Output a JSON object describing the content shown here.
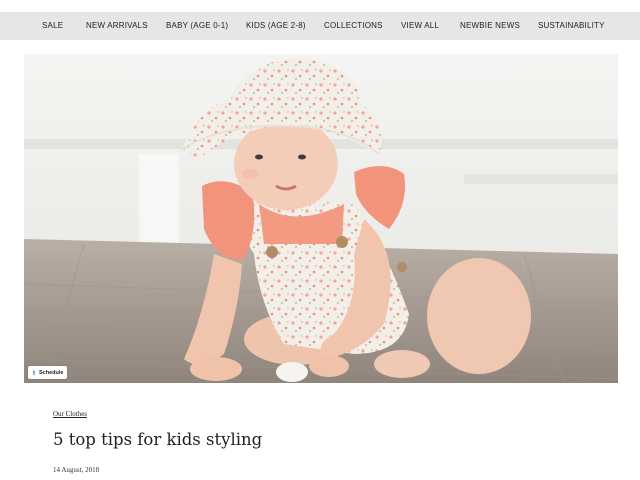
{
  "nav": {
    "items": [
      {
        "label": "SALE"
      },
      {
        "label": "NEW ARRIVALS"
      },
      {
        "label": "BABY (AGE 0-1)"
      },
      {
        "label": "KIDS (AGE 2-8)"
      },
      {
        "label": "COLLECTIONS"
      },
      {
        "label": "VIEW ALL"
      },
      {
        "label": "NEWBIE NEWS"
      },
      {
        "label": "SUSTAINABILITY"
      }
    ]
  },
  "hero": {
    "schedule_label": "Schedule",
    "schedule_icon": "pin-icon"
  },
  "article": {
    "category": "Our Clothes",
    "title": "5 top tips for kids styling",
    "date": "14 August, 2018"
  },
  "colors": {
    "nav_background": "#e6e6e6",
    "text": "#222222",
    "ruffle_coral": "#f2947c",
    "schedule_icon": "#3b8fd6"
  }
}
